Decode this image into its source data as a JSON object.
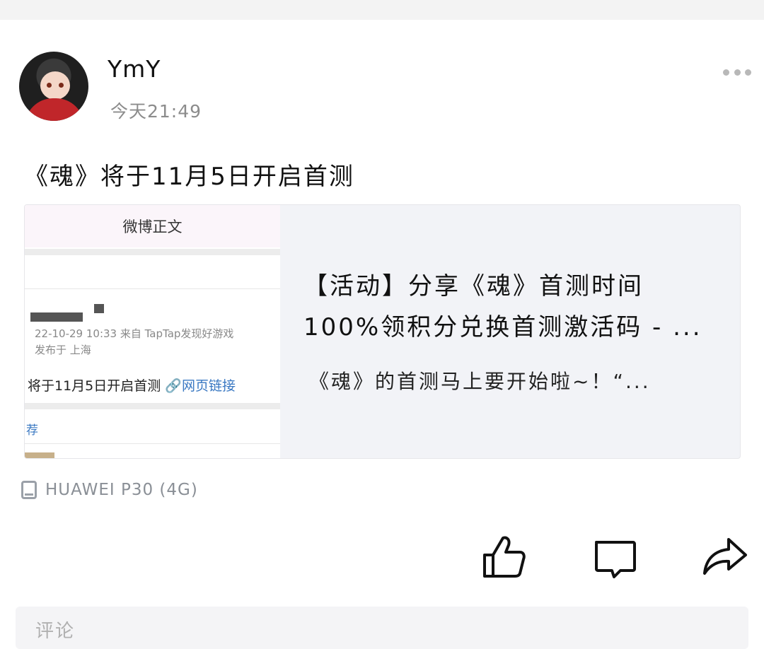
{
  "post": {
    "username": "YmY",
    "time": "今天21:49",
    "text": "《魂》将于11月5日开启首测",
    "device": "HUAWEI P30 (4G)"
  },
  "link_card": {
    "title_line1": "【活动】分享《魂》首测时间",
    "title_line2": "100%领积分兑换首测激活码 - ...",
    "description": "《魂》的首测马上要开始啦~！“...",
    "thumbnail": {
      "header": "微博正文",
      "date_line": "22-10-29 10:33  来自 TapTap发现好游戏",
      "location_line": "发布于 上海",
      "body_text": "将于11月5日开启首测",
      "link_text": "🔗网页链接",
      "recommend": "荐"
    }
  },
  "comment": {
    "placeholder": "评论"
  },
  "icons": {
    "more": "more-icon",
    "like": "thumbs-up-icon",
    "comment": "comment-icon",
    "share": "share-icon",
    "device": "phone-icon"
  }
}
